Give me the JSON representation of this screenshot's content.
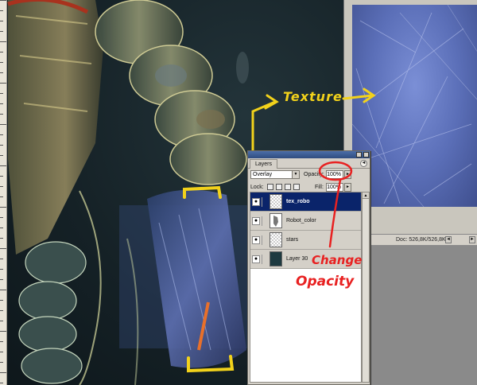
{
  "ruler": {
    "ticks": 38
  },
  "palette": {
    "tab_label": "Layers",
    "menu_glyph": "◄",
    "blend_mode": "Overlay",
    "dropdown_glyph": "▼",
    "opacity_label": "Opacity:",
    "opacity_value": "100%",
    "slider_glyph": "►",
    "lock_label": "Lock:",
    "fill_label": "Fill:",
    "fill_value": "100%",
    "scroll_up_glyph": "▲",
    "layers": [
      {
        "name": "tex_robo",
        "thumb": "checker",
        "selected": true
      },
      {
        "name": "Robot_color",
        "thumb": "robo",
        "selected": false
      },
      {
        "name": "stars",
        "thumb": "checker",
        "selected": false
      },
      {
        "name": "Layer 30",
        "thumb": "dark",
        "selected": false
      }
    ],
    "eye_glyph": "●"
  },
  "texture_window": {
    "doc_status": "Doc: 526,8K/526,8K",
    "scroll_left_glyph": "◄",
    "scroll_right_glyph": "►"
  },
  "annotations": {
    "texture_label": "Texture",
    "change_label": "Change",
    "opacity_label": "Opacity"
  },
  "colors": {
    "annotation_yellow": "#f2d21b",
    "annotation_red": "#e82121",
    "selected_layer": "#0a246a"
  }
}
